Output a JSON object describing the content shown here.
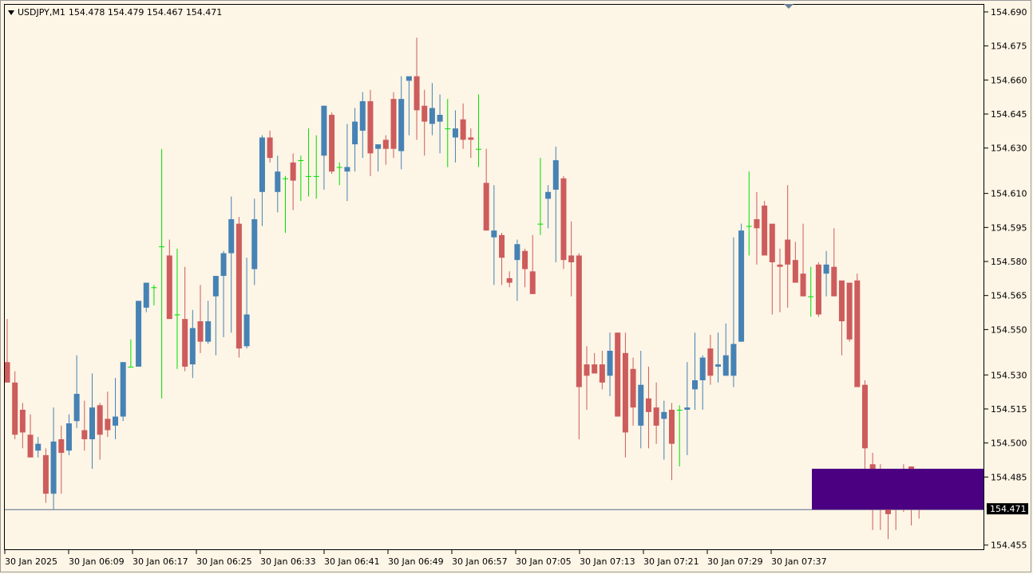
{
  "symbol": {
    "name": "USDJPY,M1",
    "ohlc": "154.478 154.479 154.467 154.471"
  },
  "colors": {
    "bull": "#4682b4",
    "bear": "#cd5c5c",
    "doji": "#00dd00",
    "price_line": "#5a6d8c",
    "box": "#4b0082",
    "label_bg": "#000000"
  },
  "icons": {
    "menu": "triangle-down-icon",
    "shift_marker": "triangle-down-icon"
  },
  "current_price": "154.471",
  "box_zone": {
    "from_price": 154.471,
    "to_price": 154.489
  },
  "chart_data": {
    "type": "candlestick",
    "y_ticks": [
      "154.690",
      "154.675",
      "154.660",
      "154.645",
      "154.630",
      "154.610",
      "154.595",
      "154.580",
      "154.565",
      "154.550",
      "154.530",
      "154.515",
      "154.500",
      "154.485",
      "154.455"
    ],
    "x_ticks": [
      "30 Jan 2025",
      "30 Jan 06:09",
      "30 Jan 06:17",
      "30 Jan 06:25",
      "30 Jan 06:33",
      "30 Jan 06:41",
      "30 Jan 06:49",
      "30 Jan 06:57",
      "30 Jan 07:05",
      "30 Jan 07:13",
      "30 Jan 07:21",
      "30 Jan 07:29",
      "30 Jan 07:37"
    ],
    "ylim": [
      154.4535,
      154.6935
    ],
    "candles": [
      [
        154.536,
        154.555,
        154.527,
        154.527
      ],
      [
        154.527,
        154.532,
        154.502,
        154.504
      ],
      [
        154.515,
        154.518,
        154.498,
        154.505
      ],
      [
        154.504,
        154.513,
        154.494,
        154.494
      ],
      [
        154.497,
        154.503,
        154.494,
        154.5
      ],
      [
        154.495,
        154.498,
        154.474,
        154.478
      ],
      [
        154.478,
        154.516,
        154.471,
        154.501
      ],
      [
        154.502,
        154.508,
        154.478,
        154.496
      ],
      [
        154.497,
        154.513,
        154.495,
        154.509
      ],
      [
        154.51,
        154.539,
        154.507,
        154.522
      ],
      [
        154.506,
        154.519,
        154.497,
        154.502
      ],
      [
        154.502,
        154.531,
        154.489,
        154.516
      ],
      [
        154.517,
        154.518,
        154.493,
        154.504
      ],
      [
        154.511,
        154.523,
        154.503,
        154.506
      ],
      [
        154.508,
        154.529,
        154.502,
        154.512
      ],
      [
        154.512,
        154.536,
        154.51,
        154.536
      ],
      [
        154.534,
        154.546,
        154.534,
        154.534
      ],
      [
        154.534,
        154.563,
        154.534,
        154.563
      ],
      [
        154.56,
        154.57,
        154.558,
        154.571
      ],
      [
        154.569,
        154.57,
        154.561,
        154.569
      ],
      [
        154.587,
        154.63,
        154.52,
        154.587
      ],
      [
        154.583,
        154.59,
        154.555,
        154.555
      ],
      [
        154.557,
        154.586,
        154.533,
        154.557
      ],
      [
        154.555,
        154.578,
        154.532,
        154.534
      ],
      [
        154.535,
        154.559,
        154.529,
        154.551
      ],
      [
        154.554,
        154.57,
        154.54,
        154.545
      ],
      [
        154.545,
        154.563,
        154.544,
        154.554
      ],
      [
        154.565,
        154.573,
        154.539,
        154.574
      ],
      [
        154.574,
        154.585,
        154.547,
        154.584
      ],
      [
        154.584,
        154.609,
        154.549,
        154.599
      ],
      [
        154.597,
        154.6,
        154.538,
        154.542
      ],
      [
        154.543,
        154.582,
        154.542,
        154.557
      ],
      [
        154.577,
        154.608,
        154.57,
        154.599
      ],
      [
        154.611,
        154.636,
        154.596,
        154.635
      ],
      [
        154.635,
        154.638,
        154.624,
        154.626
      ],
      [
        154.611,
        154.627,
        154.602,
        154.62
      ],
      [
        154.617,
        154.618,
        154.593,
        154.617
      ],
      [
        154.624,
        154.628,
        154.603,
        154.616
      ],
      [
        154.625,
        154.627,
        154.607,
        154.625
      ],
      [
        154.618,
        154.639,
        154.609,
        154.618
      ],
      [
        154.618,
        154.636,
        154.608,
        154.618
      ],
      [
        154.627,
        154.649,
        154.612,
        154.649
      ],
      [
        154.645,
        154.646,
        154.619,
        154.62
      ],
      [
        154.622,
        154.624,
        154.614,
        154.622
      ],
      [
        154.62,
        154.641,
        154.607,
        154.622
      ],
      [
        154.632,
        154.648,
        154.62,
        154.642
      ],
      [
        154.638,
        154.655,
        154.626,
        154.651
      ],
      [
        154.651,
        154.656,
        154.618,
        154.628
      ],
      [
        154.63,
        154.63,
        154.62,
        154.632
      ],
      [
        154.634,
        154.636,
        154.623,
        154.63
      ],
      [
        154.652,
        154.655,
        154.626,
        154.63
      ],
      [
        154.629,
        154.662,
        154.621,
        154.652
      ],
      [
        154.66,
        154.66,
        154.636,
        154.662
      ],
      [
        154.662,
        154.679,
        154.634,
        154.647
      ],
      [
        154.649,
        154.656,
        154.627,
        154.642
      ],
      [
        154.641,
        154.659,
        154.636,
        154.648
      ],
      [
        154.642,
        154.654,
        154.628,
        154.645
      ],
      [
        154.639,
        154.652,
        154.622,
        154.639
      ],
      [
        154.635,
        154.647,
        154.624,
        154.639
      ],
      [
        154.643,
        154.65,
        154.63,
        154.634
      ],
      [
        154.635,
        154.639,
        154.626,
        154.634
      ],
      [
        154.63,
        154.654,
        154.622,
        154.63
      ],
      [
        154.615,
        154.63,
        154.594,
        154.594
      ],
      [
        154.591,
        154.614,
        154.57,
        154.594
      ],
      [
        154.592,
        154.593,
        154.57,
        154.582
      ],
      [
        154.573,
        154.576,
        154.569,
        154.571
      ],
      [
        154.581,
        154.59,
        154.563,
        154.588
      ],
      [
        154.585,
        154.586,
        154.569,
        154.577
      ],
      [
        154.576,
        154.592,
        154.569,
        154.566
      ],
      [
        154.597,
        154.626,
        154.592,
        154.597
      ],
      [
        154.608,
        154.614,
        154.595,
        154.611
      ],
      [
        154.612,
        154.631,
        154.58,
        154.625
      ],
      [
        154.617,
        154.618,
        154.577,
        154.581
      ],
      [
        154.583,
        154.598,
        154.565,
        154.58
      ],
      [
        154.583,
        154.584,
        154.502,
        154.525
      ],
      [
        154.535,
        154.543,
        154.515,
        154.53
      ],
      [
        154.535,
        154.54,
        154.535,
        154.531
      ],
      [
        154.535,
        154.541,
        154.524,
        154.527
      ],
      [
        154.53,
        154.549,
        154.521,
        154.541
      ],
      [
        154.549,
        154.549,
        154.512,
        154.512
      ],
      [
        154.54,
        154.549,
        154.494,
        154.505
      ],
      [
        154.533,
        154.538,
        154.508,
        154.516
      ],
      [
        154.508,
        154.541,
        154.498,
        154.526
      ],
      [
        154.52,
        154.534,
        154.498,
        154.514
      ],
      [
        154.516,
        154.527,
        154.5,
        154.508
      ],
      [
        154.511,
        154.519,
        154.493,
        154.514
      ],
      [
        154.515,
        154.518,
        154.484,
        154.5
      ],
      [
        154.515,
        154.517,
        154.49,
        154.515
      ],
      [
        154.515,
        154.536,
        154.495,
        154.516
      ],
      [
        154.524,
        154.549,
        154.515,
        154.528
      ],
      [
        154.528,
        154.539,
        154.515,
        154.538
      ],
      [
        154.542,
        154.548,
        154.526,
        154.53
      ],
      [
        154.534,
        154.549,
        154.527,
        154.535
      ],
      [
        154.53,
        154.553,
        154.53,
        154.539
      ],
      [
        154.53,
        154.591,
        154.525,
        154.544
      ],
      [
        154.545,
        154.597,
        154.545,
        154.594
      ],
      [
        154.596,
        154.62,
        154.583,
        154.596
      ],
      [
        154.599,
        154.611,
        154.579,
        154.595
      ],
      [
        154.605,
        154.607,
        154.59,
        154.583
      ],
      [
        154.597,
        154.588,
        154.557,
        154.58
      ],
      [
        154.579,
        154.586,
        154.558,
        154.578
      ],
      [
        154.59,
        154.614,
        154.56,
        154.579
      ],
      [
        154.581,
        154.589,
        154.574,
        154.571
      ],
      [
        154.575,
        154.597,
        154.565,
        154.565
      ],
      [
        154.565,
        154.578,
        154.556,
        154.565
      ],
      [
        154.579,
        154.58,
        154.556,
        154.557
      ],
      [
        154.575,
        154.585,
        154.565,
        154.579
      ],
      [
        154.578,
        154.595,
        154.566,
        154.565
      ],
      [
        154.572,
        154.565,
        154.539,
        154.554
      ],
      [
        154.571,
        154.568,
        154.545,
        154.546
      ],
      [
        154.572,
        154.575,
        154.527,
        154.525
      ],
      [
        154.526,
        154.528,
        154.486,
        154.498
      ],
      [
        154.491,
        154.496,
        154.462,
        154.483
      ],
      [
        154.488,
        154.491,
        154.462,
        154.476
      ],
      [
        154.477,
        154.489,
        154.458,
        154.469
      ],
      [
        154.484,
        154.488,
        154.462,
        154.479
      ],
      [
        154.489,
        154.491,
        154.47,
        154.481
      ],
      [
        154.49,
        154.49,
        154.464,
        154.477
      ],
      [
        154.478,
        154.479,
        154.467,
        154.471
      ]
    ]
  }
}
